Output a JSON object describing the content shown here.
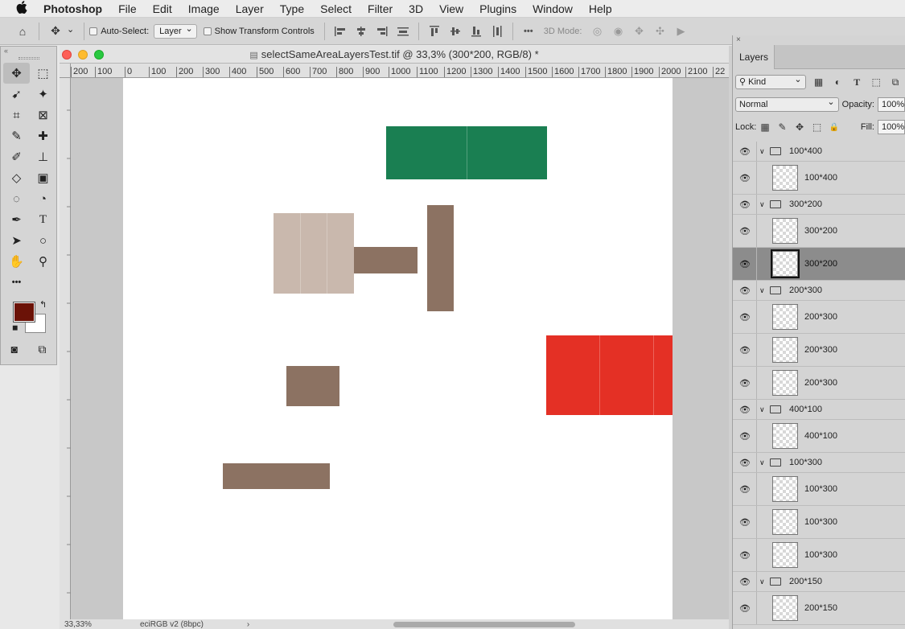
{
  "menubar": {
    "apple": "",
    "app": "Photoshop",
    "items": [
      "File",
      "Edit",
      "Image",
      "Layer",
      "Type",
      "Select",
      "Filter",
      "3D",
      "View",
      "Plugins",
      "Window",
      "Help"
    ]
  },
  "options": {
    "home": "⌂",
    "move": "✥",
    "move_caret": "⌄",
    "auto_select_label": "Auto-Select:",
    "auto_select_value": "Layer",
    "show_transform_label": "Show Transform Controls",
    "more": "•••",
    "mode_3d_label": "3D Mode:"
  },
  "document": {
    "title": "selectSameAreaLayersTest.tif @ 33,3% (300*200, RGB/8) *",
    "file_icon": "▤",
    "zoom": "33,33%",
    "profile": "eciRGB v2 (8bpc)",
    "status_arrow": "›",
    "ruler_ticks": [
      "200",
      "100",
      "0",
      "100",
      "200",
      "300",
      "400",
      "500",
      "600",
      "700",
      "800",
      "900",
      "1000",
      "1100",
      "1200",
      "1300",
      "1400",
      "1500",
      "1600",
      "1700",
      "1800",
      "1900",
      "2000",
      "2100",
      "22"
    ]
  },
  "tools": {
    "collapse": "«",
    "fg_color": "#6b1207",
    "bg_color": "#ffffff",
    "swap": "↰",
    "default_colors": "◼",
    "items": [
      {
        "name": "move-tool",
        "glyph": "✥"
      },
      {
        "name": "marquee-tool",
        "glyph": "⬚"
      },
      {
        "name": "lasso-tool",
        "glyph": "➹"
      },
      {
        "name": "magic-wand-tool",
        "glyph": "✦"
      },
      {
        "name": "crop-tool",
        "glyph": "⌗"
      },
      {
        "name": "frame-tool",
        "glyph": "⊠"
      },
      {
        "name": "eyedropper-tool",
        "glyph": "✎"
      },
      {
        "name": "healing-brush-tool",
        "glyph": "✚"
      },
      {
        "name": "brush-tool",
        "glyph": "✐"
      },
      {
        "name": "stamp-tool",
        "glyph": "⊥"
      },
      {
        "name": "eraser-tool",
        "glyph": "◇"
      },
      {
        "name": "gradient-tool",
        "glyph": "▣"
      },
      {
        "name": "blur-tool",
        "glyph": "◌"
      },
      {
        "name": "dodge-tool",
        "glyph": "◔"
      },
      {
        "name": "pen-tool",
        "glyph": "✒"
      },
      {
        "name": "type-tool",
        "glyph": "T"
      },
      {
        "name": "path-selection-tool",
        "glyph": "➤"
      },
      {
        "name": "ellipse-tool",
        "glyph": "○"
      },
      {
        "name": "hand-tool",
        "glyph": "✋"
      },
      {
        "name": "zoom-tool",
        "glyph": "⚲"
      },
      {
        "name": "more-tools",
        "glyph": "•••"
      },
      {
        "name": "blank",
        "glyph": ""
      }
    ],
    "quick_mask": "◙",
    "screen_mode": "⧉"
  },
  "canvas_shapes": [
    {
      "color": "#1a7f52"
    },
    {
      "color": "#c9b8ad"
    },
    {
      "color": "#8c7262"
    },
    {
      "color": "#8c7262"
    },
    {
      "color": "#e43025"
    },
    {
      "color": "#8c7262"
    },
    {
      "color": "#8c7262"
    }
  ],
  "layers_panel": {
    "close": "×",
    "collapse": "»",
    "tab": "Layers",
    "filter_kind": "Kind",
    "filter_search_icon": "⚲",
    "filter_icons": [
      "▦",
      "◐",
      "T",
      "⬚",
      "⧉"
    ],
    "blend_mode": "Normal",
    "opacity_label": "Opacity:",
    "opacity_value": "100%",
    "lock_label": "Lock:",
    "lock_icons": [
      "▦",
      "✎",
      "✥",
      "⬚",
      "🔒"
    ],
    "fill_label": "Fill:",
    "fill_value": "100%",
    "eye": "👁",
    "caret": "∨",
    "layers": [
      {
        "type": "group",
        "name": "100*400"
      },
      {
        "type": "item",
        "name": "100*400"
      },
      {
        "type": "group",
        "name": "300*200"
      },
      {
        "type": "item",
        "name": "300*200"
      },
      {
        "type": "item",
        "name": "300*200",
        "selected": true
      },
      {
        "type": "group",
        "name": "200*300"
      },
      {
        "type": "item",
        "name": "200*300"
      },
      {
        "type": "item",
        "name": "200*300"
      },
      {
        "type": "item",
        "name": "200*300"
      },
      {
        "type": "group",
        "name": "400*100"
      },
      {
        "type": "item",
        "name": "400*100"
      },
      {
        "type": "group",
        "name": "100*300"
      },
      {
        "type": "item",
        "name": "100*300"
      },
      {
        "type": "item",
        "name": "100*300"
      },
      {
        "type": "item",
        "name": "100*300"
      },
      {
        "type": "group",
        "name": "200*150"
      },
      {
        "type": "item",
        "name": "200*150"
      }
    ]
  }
}
